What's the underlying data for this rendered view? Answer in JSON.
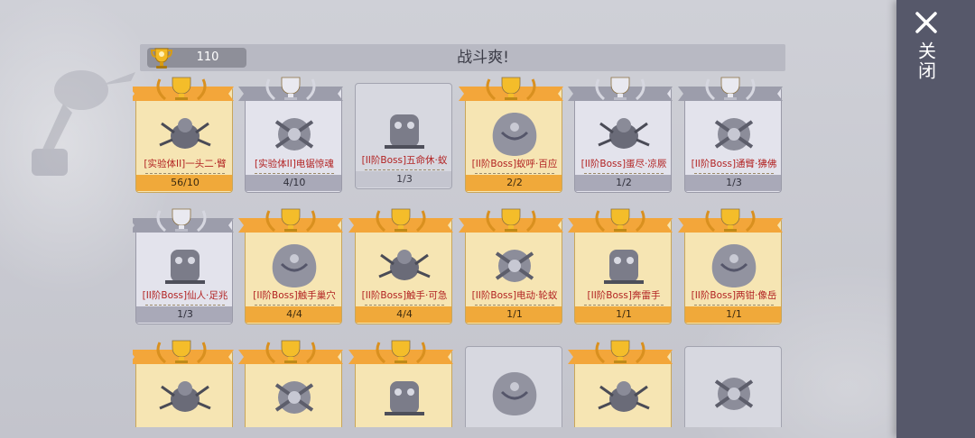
{
  "header": {
    "score": "110",
    "title": "战斗爽!"
  },
  "side_panel": {
    "close_label": "关闭"
  },
  "colors": {
    "gold_progress": "#f0a93a",
    "silver_progress": "#a9a9b8",
    "name_red": "#b22222",
    "panel": "#56586a"
  },
  "cards": [
    {
      "name": "[实验体II]一头二·臂",
      "progress": "56/10",
      "tier": "gold"
    },
    {
      "name": "[实验体II]电锯惊魂",
      "progress": "4/10",
      "tier": "silver"
    },
    {
      "name": "[II阶Boss]五命休·蚁",
      "progress": "1/3",
      "tier": "plain"
    },
    {
      "name": "[II阶Boss]蚁呼·百应",
      "progress": "2/2",
      "tier": "gold"
    },
    {
      "name": "[II阶Boss]蛋尽·凉厥",
      "progress": "1/2",
      "tier": "silver"
    },
    {
      "name": "[II阶Boss]通臂·狒佛",
      "progress": "1/3",
      "tier": "silver"
    },
    {
      "name": "[II阶Boss]仙人·足兆",
      "progress": "1/3",
      "tier": "silver"
    },
    {
      "name": "[II阶Boss]触手巢穴",
      "progress": "4/4",
      "tier": "gold"
    },
    {
      "name": "[II阶Boss]触手·可急",
      "progress": "4/4",
      "tier": "gold"
    },
    {
      "name": "[II阶Boss]电动·轮蚁",
      "progress": "1/1",
      "tier": "gold"
    },
    {
      "name": "[II阶Boss]奔雷手",
      "progress": "1/1",
      "tier": "gold"
    },
    {
      "name": "[II阶Boss]两钳·像岳",
      "progress": "1/1",
      "tier": "gold"
    },
    {
      "name": "",
      "progress": "",
      "tier": "gold"
    },
    {
      "name": "",
      "progress": "",
      "tier": "gold"
    },
    {
      "name": "",
      "progress": "",
      "tier": "gold"
    },
    {
      "name": "",
      "progress": "",
      "tier": "plain"
    },
    {
      "name": "",
      "progress": "",
      "tier": "gold"
    },
    {
      "name": "",
      "progress": "",
      "tier": "plain"
    }
  ],
  "icons": {
    "trophy": "trophy-icon",
    "close": "close-x-icon",
    "monster": "monster-portrait-icon"
  }
}
